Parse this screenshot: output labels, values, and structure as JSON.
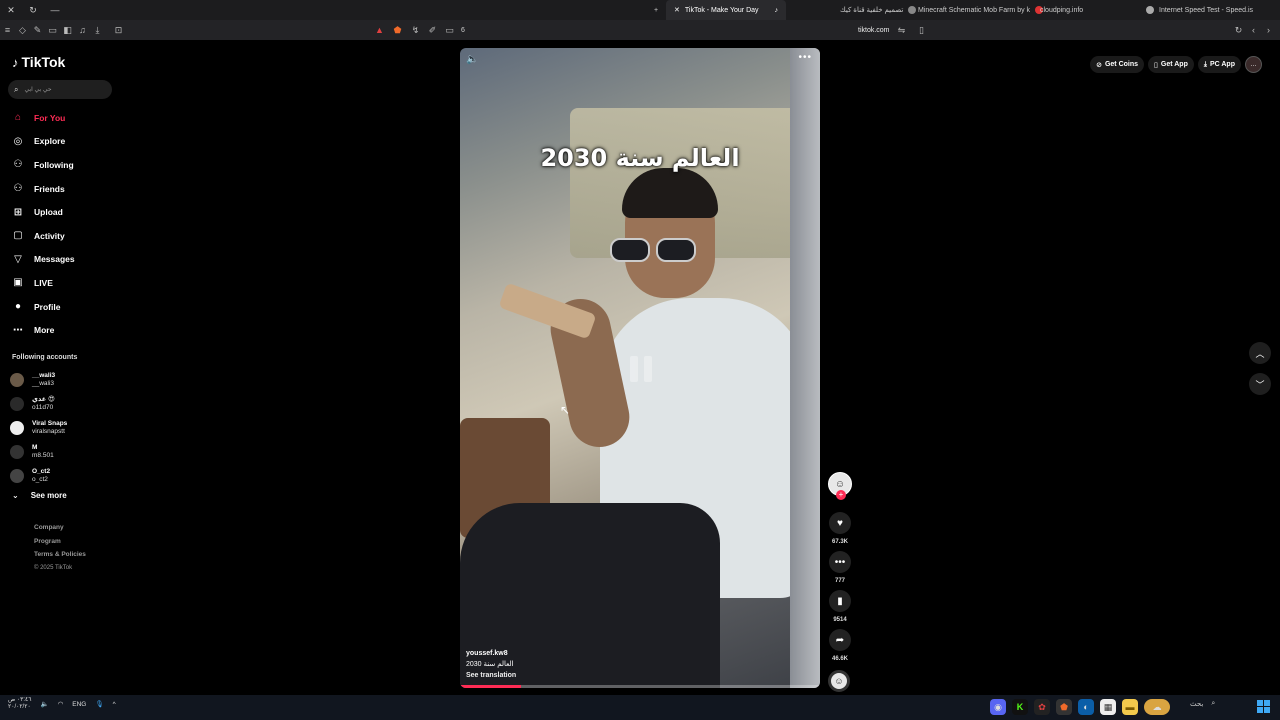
{
  "browser": {
    "tabs": [
      {
        "title": "TikTok - Make Your Day",
        "active": true
      },
      {
        "title": "تصميم خلفية قناة كيك",
        "active": false
      },
      {
        "title": "Minecraft Schematic Mob Farm by k",
        "active": false
      },
      {
        "title": "cloudping.info",
        "active": false
      },
      {
        "title": "Internet Speed Test - Speed.is",
        "active": false
      }
    ],
    "address": "tiktok.com",
    "tab_count": "6",
    "new_tab": "+"
  },
  "sidebar": {
    "logo": "TikTok",
    "search_placeholder": "حي بي ابي",
    "nav": [
      {
        "label": "For You",
        "icon": "home-icon",
        "glyph": "⌂",
        "active": true
      },
      {
        "label": "Explore",
        "icon": "compass-icon",
        "glyph": "◎",
        "active": false
      },
      {
        "label": "Following",
        "icon": "following-icon",
        "glyph": "⚇",
        "active": false
      },
      {
        "label": "Friends",
        "icon": "friends-icon",
        "glyph": "⚇",
        "active": false
      },
      {
        "label": "Upload",
        "icon": "upload-icon",
        "glyph": "⊞",
        "active": false
      },
      {
        "label": "Activity",
        "icon": "activity-icon",
        "glyph": "▢",
        "active": false
      },
      {
        "label": "Messages",
        "icon": "messages-icon",
        "glyph": "▽",
        "active": false
      },
      {
        "label": "LIVE",
        "icon": "live-icon",
        "glyph": "▣",
        "active": false
      },
      {
        "label": "Profile",
        "icon": "profile-icon",
        "glyph": "●",
        "active": false
      },
      {
        "label": "More",
        "icon": "more-icon",
        "glyph": "⋯",
        "active": false
      }
    ],
    "following_title": "Following accounts",
    "following": [
      {
        "name": "__wali3",
        "handle": "__wali3"
      },
      {
        "name": "غدي 😍",
        "handle": "o11d70"
      },
      {
        "name": "Viral Snaps",
        "handle": "viralsnapstt"
      },
      {
        "name": "M",
        "handle": "m8.501"
      },
      {
        "name": "O_ct2",
        "handle": "o_ct2"
      }
    ],
    "see_more": "See more",
    "footer": {
      "company": "Company",
      "program": "Program",
      "terms": "Terms & Policies",
      "copyright": "© 2025 TikTok"
    }
  },
  "top_actions": {
    "get_coins": "Get Coins",
    "get_app": "Get App",
    "pc_app": "PC App"
  },
  "video": {
    "overlay_text": "العالم سنة 2030",
    "author": "youssef.kw8",
    "description": "العالم سنة 2030",
    "see_translation": "See translation",
    "progress": 0.17
  },
  "actions": {
    "likes": "67.3K",
    "comments": "777",
    "saves": "9514",
    "shares": "46.6K"
  },
  "taskbar": {
    "time": "٠٣:٤٦ ص",
    "date": "٢٠/٠٢/٢٠",
    "language": "ENG",
    "search_label": "بحث"
  },
  "colors": {
    "accent": "#fe2c55",
    "background": "#000000"
  }
}
